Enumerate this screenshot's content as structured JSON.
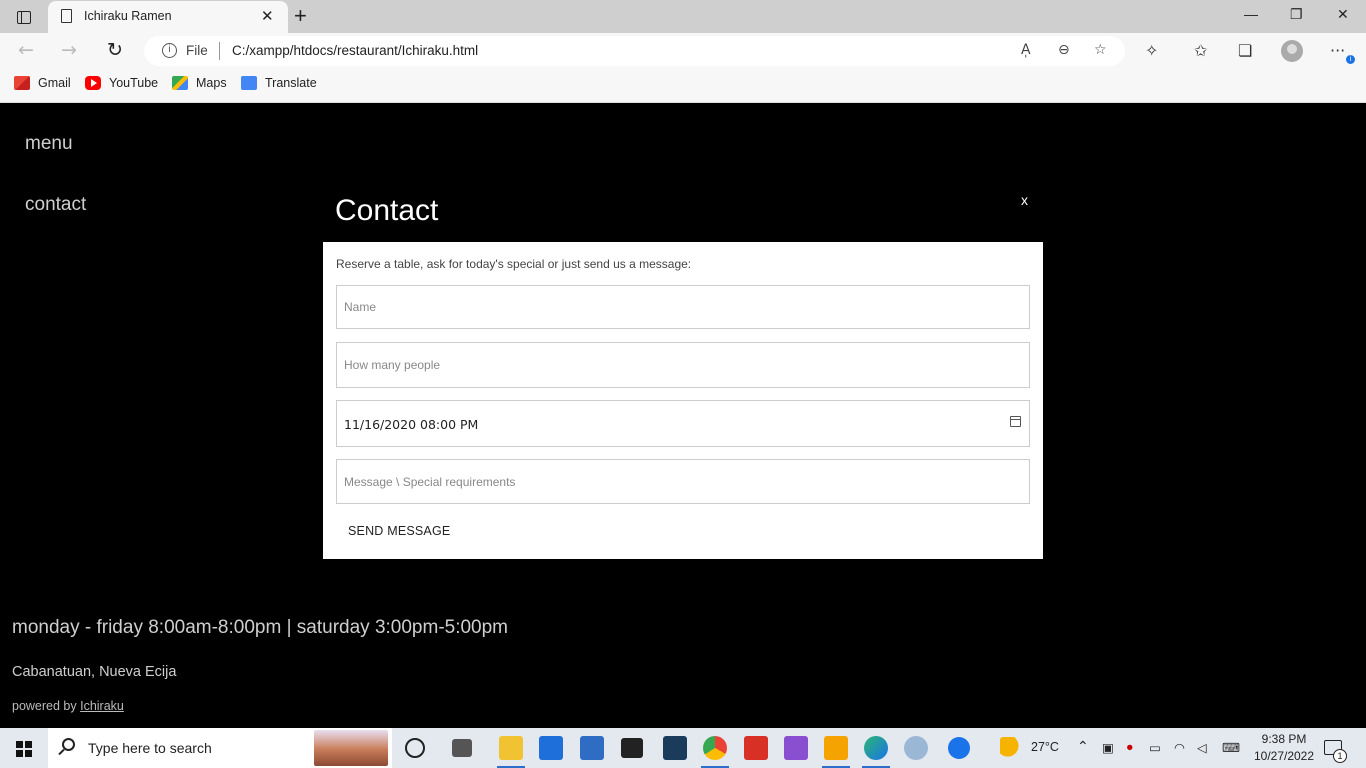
{
  "browser": {
    "tab_title": "Ichiraku Ramen",
    "tab_close": "✕",
    "new_tab": "+",
    "window_controls": {
      "minimize": "—",
      "restore": "❐",
      "close": "✕"
    },
    "nav": {
      "back": "←",
      "forward": "→",
      "reload": "↻"
    },
    "address": {
      "info": "i",
      "scheme": "File",
      "url": "C:/xampp/htdocs/restaurant/Ichiraku.html"
    },
    "address_icons": {
      "read_aloud": "A̩",
      "zoom": "⊖",
      "favorite": "☆"
    },
    "toolbar_icons": {
      "extensions": "✧",
      "favorites": "✩",
      "collections": "❏",
      "more": "···"
    },
    "profile_badge": "i",
    "bookmarks": [
      {
        "label": "Gmail",
        "icon": "gmail-icon"
      },
      {
        "label": "YouTube",
        "icon": "youtube-icon"
      },
      {
        "label": "Maps",
        "icon": "maps-icon"
      },
      {
        "label": "Translate",
        "icon": "translate-icon"
      }
    ]
  },
  "page": {
    "nav": {
      "menu": "menu",
      "contact": "contact"
    },
    "modal": {
      "title": "Contact",
      "close": "x",
      "intro": "Reserve a table, ask for today's special or just send us a message:",
      "name_placeholder": "Name",
      "people_placeholder": "How many people",
      "datetime_value": "11/16/2020 08:00 PM",
      "message_placeholder": "Message \\ Special requirements",
      "send_label": "SEND MESSAGE"
    },
    "footer": {
      "hours": "monday - friday 8:00am-8:00pm | saturday 3:00pm-5:00pm",
      "address": "Cabanatuan, Nueva Ecija",
      "powered_prefix": "powered by",
      "powered_link": "Ichiraku"
    }
  },
  "taskbar": {
    "search_placeholder": "Type here to search",
    "weather": "27°C",
    "time": "9:38 PM",
    "date": "10/27/2022",
    "notification_count": "1",
    "apps": [
      "task-view",
      "widgets",
      "file-explorer",
      "microsoft-store",
      "mail",
      "dropbox",
      "visual-studio-code",
      "chrome",
      "wps-office",
      "visual-studio",
      "sublime-text",
      "edge",
      "paint",
      "help"
    ]
  },
  "colors": {
    "page_background": "#000000",
    "accent": "#2c6ecb"
  }
}
